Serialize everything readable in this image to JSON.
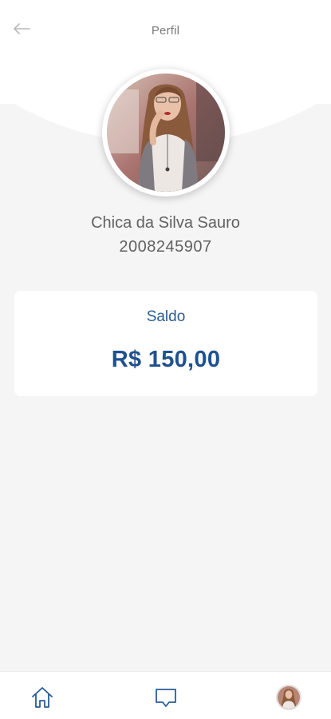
{
  "header": {
    "title": "Perfil",
    "back_icon": "arrow-left-icon"
  },
  "profile": {
    "name": "Chica da Silva Sauro",
    "id_number": "2008245907"
  },
  "balance": {
    "label": "Saldo",
    "value": "R$ 150,00"
  },
  "bottom_nav": {
    "items": [
      {
        "icon": "home-icon"
      },
      {
        "icon": "chat-icon"
      },
      {
        "icon": "avatar"
      }
    ]
  },
  "colors": {
    "primary": "#1f5190",
    "background": "#f5f5f6",
    "card": "#ffffff",
    "icon_blue": "#2a5d94"
  }
}
